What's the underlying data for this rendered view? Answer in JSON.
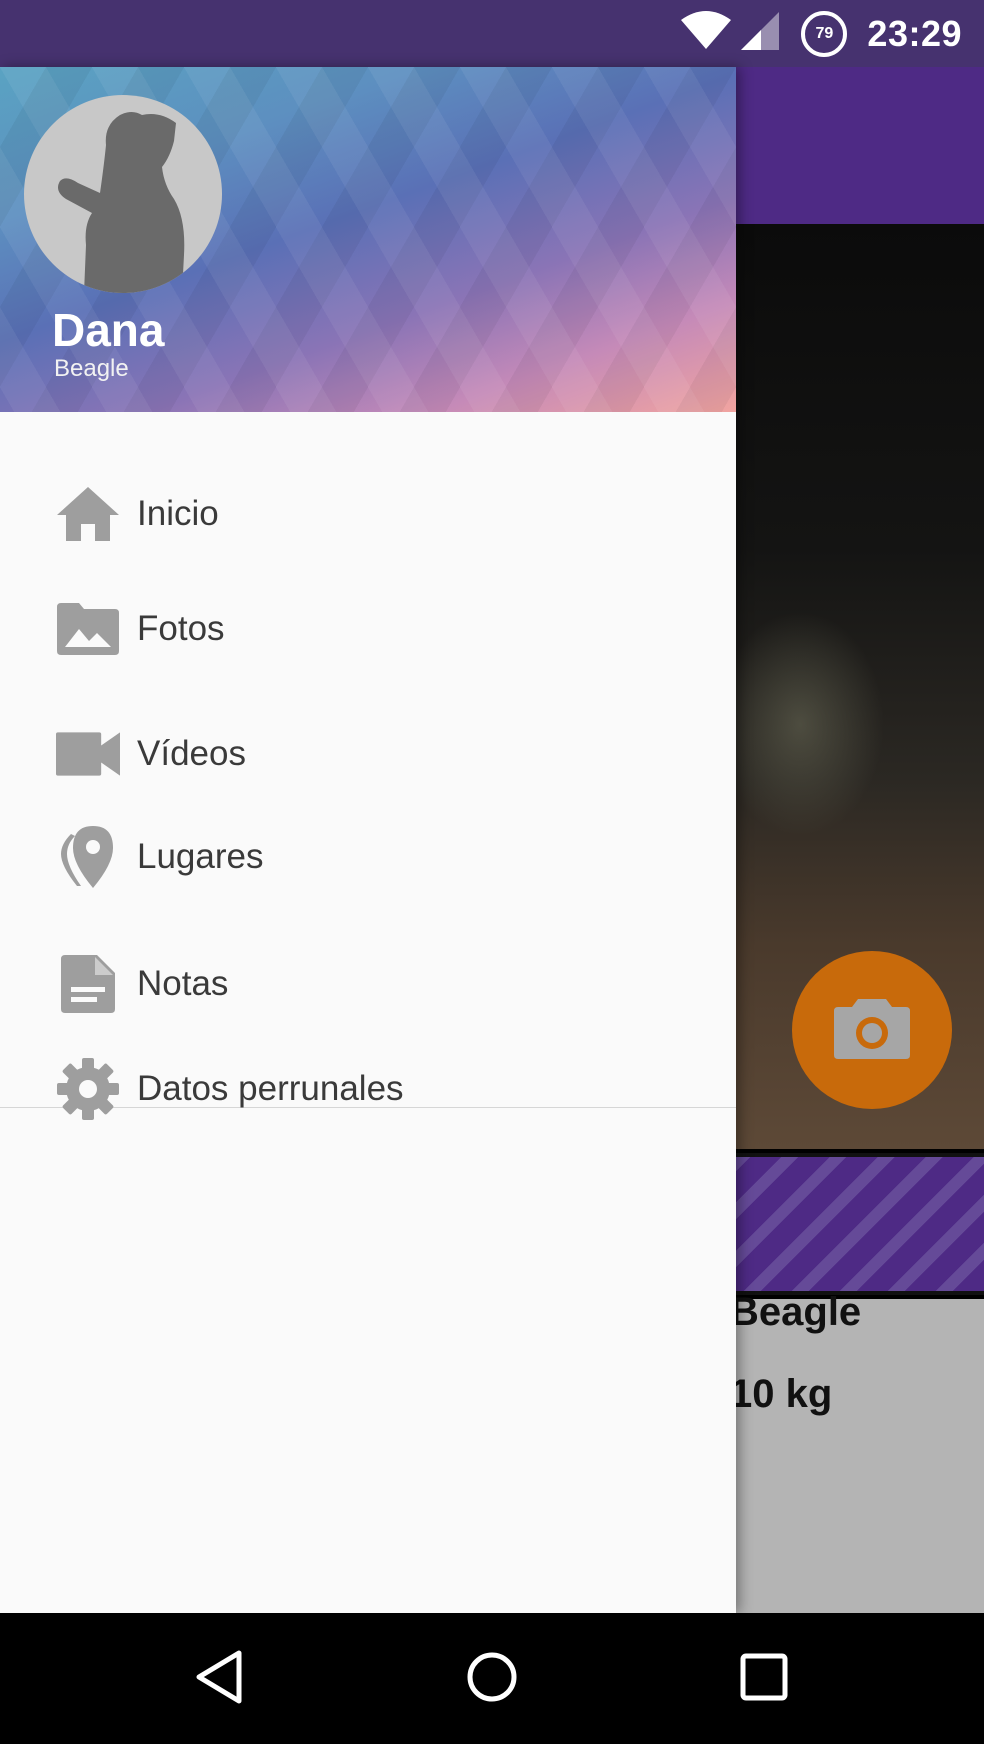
{
  "status_bar": {
    "battery_level": "79",
    "time": "23:29",
    "icons": [
      "wifi-icon",
      "cell-signal-icon",
      "battery-ring-icon"
    ]
  },
  "drawer": {
    "header": {
      "avatar_icon": "dog-silhouette-icon",
      "name": "Dana",
      "breed": "Beagle"
    },
    "items": [
      {
        "label": "Inicio",
        "icon": "home-icon"
      },
      {
        "label": "Fotos",
        "icon": "photo-icon"
      },
      {
        "label": "Vídeos",
        "icon": "videocam-icon"
      },
      {
        "label": "Lugares",
        "icon": "place-icon"
      },
      {
        "label": "Notas",
        "icon": "description-icon"
      },
      {
        "label": "Datos perrunales",
        "icon": "settings-icon"
      }
    ]
  },
  "background": {
    "breed_partial": "Beagle",
    "weight_partial": "10 kg",
    "fab_icon": "camera-icon"
  },
  "colors": {
    "status_bar": "#46326f",
    "toolbar": "#4e2a85",
    "fab": "#c86a0b",
    "icon_gray": "#9e9e9e"
  },
  "nav_bar": {
    "icons": [
      "back-icon",
      "home-circle-icon",
      "recents-icon"
    ]
  }
}
